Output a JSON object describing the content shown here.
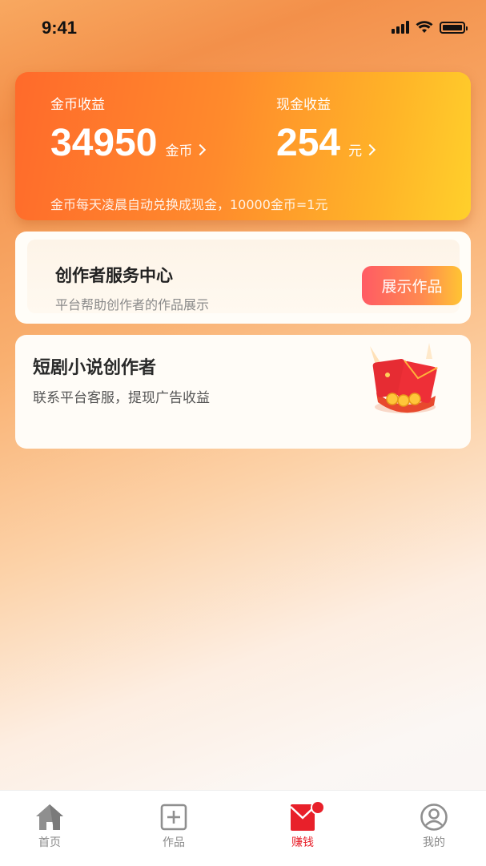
{
  "status_bar": {
    "time": "9:41"
  },
  "earnings": {
    "coin": {
      "label": "金币收益",
      "value": "34950",
      "unit": "金币"
    },
    "cash": {
      "label": "现金收益",
      "value": "254",
      "unit": "元"
    },
    "note": "金币每天凌晨自动兑换成现金，10000金币=1元",
    "colors": {
      "start": "#ff6a2b",
      "end": "#ffd02b"
    }
  },
  "creator_center": {
    "title": "创作者服务中心",
    "subtitle": "平台帮助创作者的作品展示",
    "button_label": "展示作品"
  },
  "novel_creator": {
    "title": "短剧小说创作者",
    "subtitle": "联系平台客服，提现广告收益",
    "illustration": "red-envelope-icon"
  },
  "tab_bar": {
    "items": [
      {
        "label": "首页",
        "icon": "home-icon",
        "active": false
      },
      {
        "label": "作品",
        "icon": "add-square-icon",
        "active": false
      },
      {
        "label": "赚钱",
        "icon": "red-envelope-icon",
        "active": true,
        "badge": true
      },
      {
        "label": "我的",
        "icon": "user-icon",
        "active": false
      }
    ],
    "active_color": "#e8202a"
  }
}
